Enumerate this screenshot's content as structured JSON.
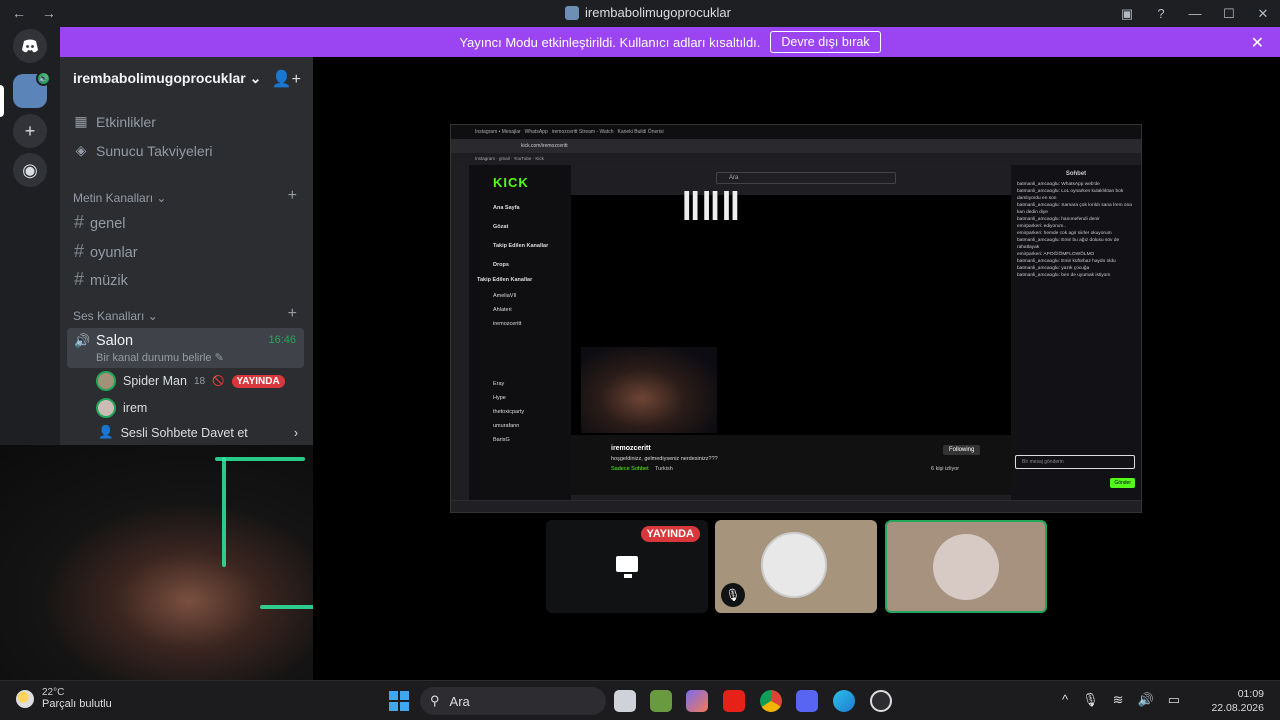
{
  "titlebar": {
    "back": "←",
    "forward": "→",
    "title": "irembabolimugoprocuklar",
    "inbox_icon": "inbox-icon",
    "help_icon": "help-icon",
    "minimize": "—",
    "maximize": "☐",
    "close": "✕"
  },
  "rail": {
    "home_icon": "discord-logo-icon",
    "add_icon": "+",
    "discover_icon": "compass-icon"
  },
  "banner": {
    "text": "Yayıncı Modu etkinleştirildi. Kullanıcı adları kısaltıldı.",
    "button": "Devre dışı bırak",
    "close": "✕"
  },
  "sidebar": {
    "guild_name": "irembabolimugoprocuklar",
    "chevron": "⌄",
    "top_items": [
      {
        "label": "Etkinlikler",
        "icon": "calendar-icon"
      },
      {
        "label": "Sunucu Takviyeleri",
        "icon": "boost-icon"
      }
    ],
    "text_category": "Metin Kanalları",
    "text_channels": [
      "genel",
      "oyunlar",
      "müzik"
    ],
    "voice_category": "Ses Kanalları",
    "voice_channel": {
      "name": "Salon",
      "status": "Bir kanal durumu belirle",
      "time": "16:46"
    },
    "members": [
      {
        "name": "Spider Man",
        "extra": "18",
        "live": "YAYINDA"
      },
      {
        "name": "irem"
      }
    ],
    "invite": "Sesli Sohbete Davet et"
  },
  "stream": {
    "kick_logo": "KICK",
    "search": "Ara",
    "left_nav": [
      "Ana Sayfa",
      "Gözat",
      "Takip Edilen Kanallar",
      "Drops"
    ],
    "followed_title": "Takip Edilen Kanallar",
    "followed": [
      "AmeliaVII",
      "Ahlateri",
      "iremozceritt",
      "Eray",
      "Hype",
      "thetoxicparty",
      "umurafann",
      "BarisG"
    ],
    "chat_title": "Sohbet",
    "chat_lines": [
      "batmanli_amcaoglu: WhatsApp web'de",
      "batmanli_amcaoglu: LoL oynarken kulaklıktan bok damlıyordu en son",
      "batmanli_amcaoglu: Samara çok kırıldı sana İrem ona kan dedin diye",
      "batmanli_amcaoglu: hanımefendi denir",
      "emirparkeri: ediyorum..",
      "emirparkeri: hemde cok agir siirler okuyorum",
      "batmanli_amcaoglu: Emir bu ağız dolusu söv de rahatlayak",
      "emirparkeri: APOĞİÖMFLOWÖLMO",
      "batmanli_amcaoglu: Emir küfürbaz haydo oldu",
      "batmanli_amcaoglu: yazık çocuğa",
      "batmanli_amcaoglu: ben de uyumak istiyom"
    ],
    "chat_placeholder": "Bir mesaj gönderin",
    "send": "Gönder",
    "channel": "iremozceritt",
    "stream_title": "hoşgeldinizz, gelmediyseniz nerdesinizz???",
    "category": "Sadece Sohbet",
    "lang": "Turkish",
    "follow": "Following",
    "viewers": "6 kişi izliyor"
  },
  "tiles": [
    {
      "name": "screen-share",
      "badge": "YAYINDA"
    },
    {
      "name": "spider-man"
    },
    {
      "name": "irem"
    }
  ],
  "taskbar": {
    "temp": "22°C",
    "weather": "Parçalı bulutlu",
    "search": "Ara",
    "time": "01:09",
    "date": "22.08.2026"
  }
}
